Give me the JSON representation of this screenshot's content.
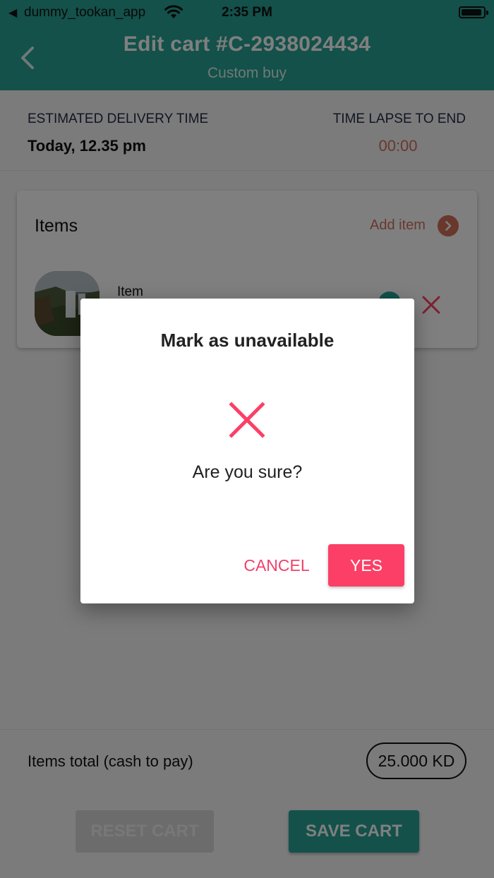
{
  "status_bar": {
    "back_glyph": "◀",
    "app_name": "dummy_tookan_app",
    "time": "2:35 PM"
  },
  "header": {
    "title": "Edit cart #C-2938024434",
    "subtitle": "Custom buy"
  },
  "delivery_info": {
    "estimated_label": "ESTIMATED DELIVERY TIME",
    "estimated_value": "Today, 12.35 pm",
    "lapse_label": "TIME LAPSE TO END",
    "lapse_value": "00:00"
  },
  "items_card": {
    "title": "Items",
    "add_label": "Add item",
    "items": [
      {
        "name": "Item"
      }
    ]
  },
  "footer": {
    "total_label": "Items total (cash to pay)",
    "total_value": "25.000 KD",
    "reset_label": "RESET CART",
    "save_label": "SAVE CART"
  },
  "dialog": {
    "title": "Mark as unavailable",
    "message": "Are you sure?",
    "cancel_label": "CANCEL",
    "confirm_label": "YES",
    "icon": "close-icon"
  },
  "colors": {
    "primary": "#26a394",
    "accent": "#d2705a",
    "danger": "#fc3f66"
  }
}
